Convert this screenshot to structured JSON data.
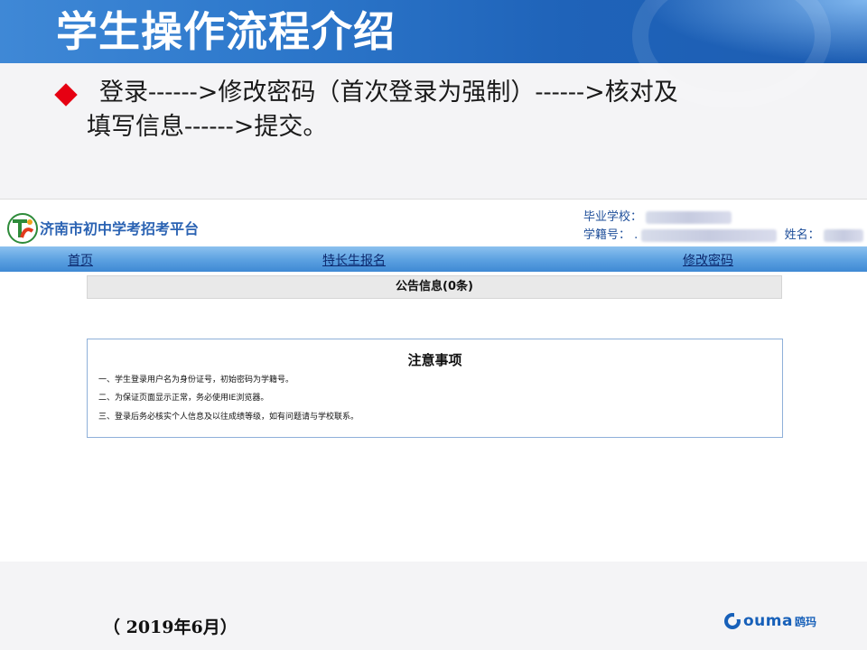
{
  "slide": {
    "title": "学生操作流程介绍",
    "bullet_line1": "登录------>修改密码（首次登录为强制）------>核对及",
    "bullet_line2": "填写信息------>提交。",
    "date": "（ 2019年6月）",
    "brand_en": "ouma",
    "brand_cn": "鸥玛",
    "colors": {
      "header_band": "#1f63b9",
      "bullet": "#e60012",
      "navbar": "#5aa0e0"
    }
  },
  "site": {
    "logo_icon": "site-logo-icon",
    "name": "济南市初中学考招考平台",
    "user": {
      "school_label": "毕业学校：",
      "student_id_label": "学籍号：",
      "student_id_prefix": ".",
      "name_label": "姓名："
    }
  },
  "nav": {
    "home": "首页",
    "talent_signup": "特长生报名",
    "change_password": "修改密码"
  },
  "notice": {
    "label": "公告信息(0条)"
  },
  "notes": {
    "title": "注意事项",
    "items": [
      "一、学生登录用户名为身份证号，初始密码为学籍号。",
      "二、为保证页面显示正常，务必使用IE浏览器。",
      "三、登录后务必核实个人信息及以往成绩等级，如有问题请与学校联系。"
    ]
  }
}
